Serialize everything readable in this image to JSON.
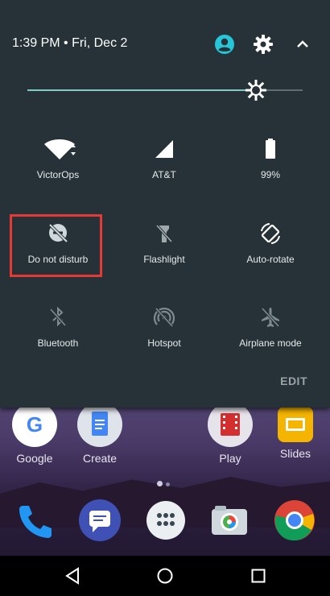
{
  "status": {
    "time_date": "1:39 PM • Fri, Dec 2"
  },
  "brightness": {
    "level": 0.83
  },
  "tiles": [
    {
      "label": "VictorOps",
      "icon": "wifi-icon"
    },
    {
      "label": "AT&T",
      "icon": "cell-signal-icon"
    },
    {
      "label": "99%",
      "icon": "battery-icon"
    },
    {
      "label": "Do not disturb",
      "icon": "do-not-disturb-icon"
    },
    {
      "label": "Flashlight",
      "icon": "flashlight-icon"
    },
    {
      "label": "Auto-rotate",
      "icon": "auto-rotate-icon"
    },
    {
      "label": "Bluetooth",
      "icon": "bluetooth-icon"
    },
    {
      "label": "Hotspot",
      "icon": "hotspot-icon"
    },
    {
      "label": "Airplane mode",
      "icon": "airplane-icon"
    }
  ],
  "edit_label": "EDIT",
  "home": {
    "apps": [
      {
        "label": "Google",
        "icon": "google-icon"
      },
      {
        "label": "Create",
        "icon": "docs-icon"
      },
      {
        "label": "Play",
        "icon": "play-movies-icon"
      },
      {
        "label": "Slides",
        "icon": "slides-icon"
      }
    ],
    "dock": [
      "phone-icon",
      "messages-icon",
      "app-drawer-icon",
      "camera-icon",
      "chrome-icon"
    ]
  },
  "colors": {
    "shade": "#263238",
    "accent": "#80cbc4",
    "highlight": "#e53935"
  }
}
